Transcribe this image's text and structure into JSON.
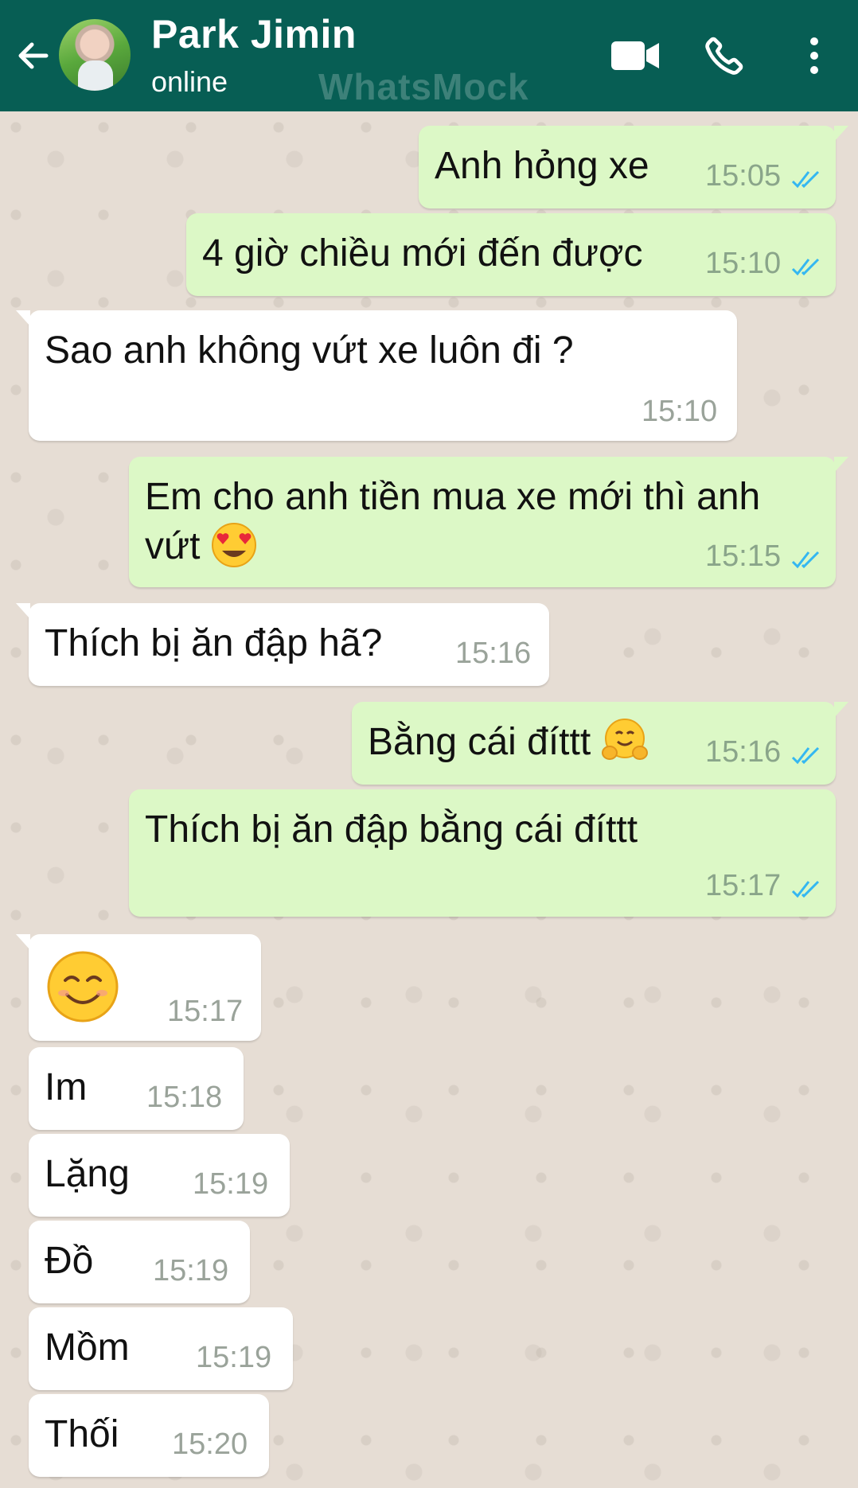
{
  "header": {
    "contact_name": "Park Jimin",
    "status": "online",
    "watermark": "WhatsMock",
    "color": "#075e54"
  },
  "icons": [
    "arrow-left-icon",
    "video-camera-icon",
    "phone-icon",
    "more-vertical-icon",
    "double-check-icon"
  ],
  "messages": [
    {
      "dir": "out",
      "text": "Anh hỏng xe",
      "time": "15:05"
    },
    {
      "dir": "out",
      "text": "4 giờ chiều mới đến được",
      "time": "15:10"
    },
    {
      "dir": "in",
      "text": "Sao anh không vứt xe luôn đi ?",
      "time": "15:10"
    },
    {
      "dir": "out",
      "text": "Em cho anh tiền mua xe mới thì anh",
      "text2": "vứt",
      "emoji": "heart-eyes-emoji",
      "time": "15:15"
    },
    {
      "dir": "in",
      "text": "Thích bị ăn đập hã?",
      "time": "15:16"
    },
    {
      "dir": "out",
      "text": "Bằng cái đíttt",
      "emoji": "hugging-face-emoji",
      "time": "15:16"
    },
    {
      "dir": "out",
      "text": "Thích bị ăn đập bằng cái đíttt",
      "time": "15:17"
    },
    {
      "dir": "in",
      "text": "",
      "emoji": "smiling-face-emoji",
      "time": "15:17"
    },
    {
      "dir": "in",
      "text": "Im",
      "time": "15:18"
    },
    {
      "dir": "in",
      "text": "Lặng",
      "time": "15:19"
    },
    {
      "dir": "in",
      "text": "Đồ",
      "time": "15:19"
    },
    {
      "dir": "in",
      "text": "Mồm",
      "time": "15:19"
    },
    {
      "dir": "in",
      "text": "Thối",
      "time": "15:20"
    }
  ],
  "colors": {
    "outgoing_bubble": "#dcf8c6",
    "incoming_bubble": "#ffffff",
    "tick": "#34b7f1",
    "chat_bg": "#e6ddd4"
  }
}
